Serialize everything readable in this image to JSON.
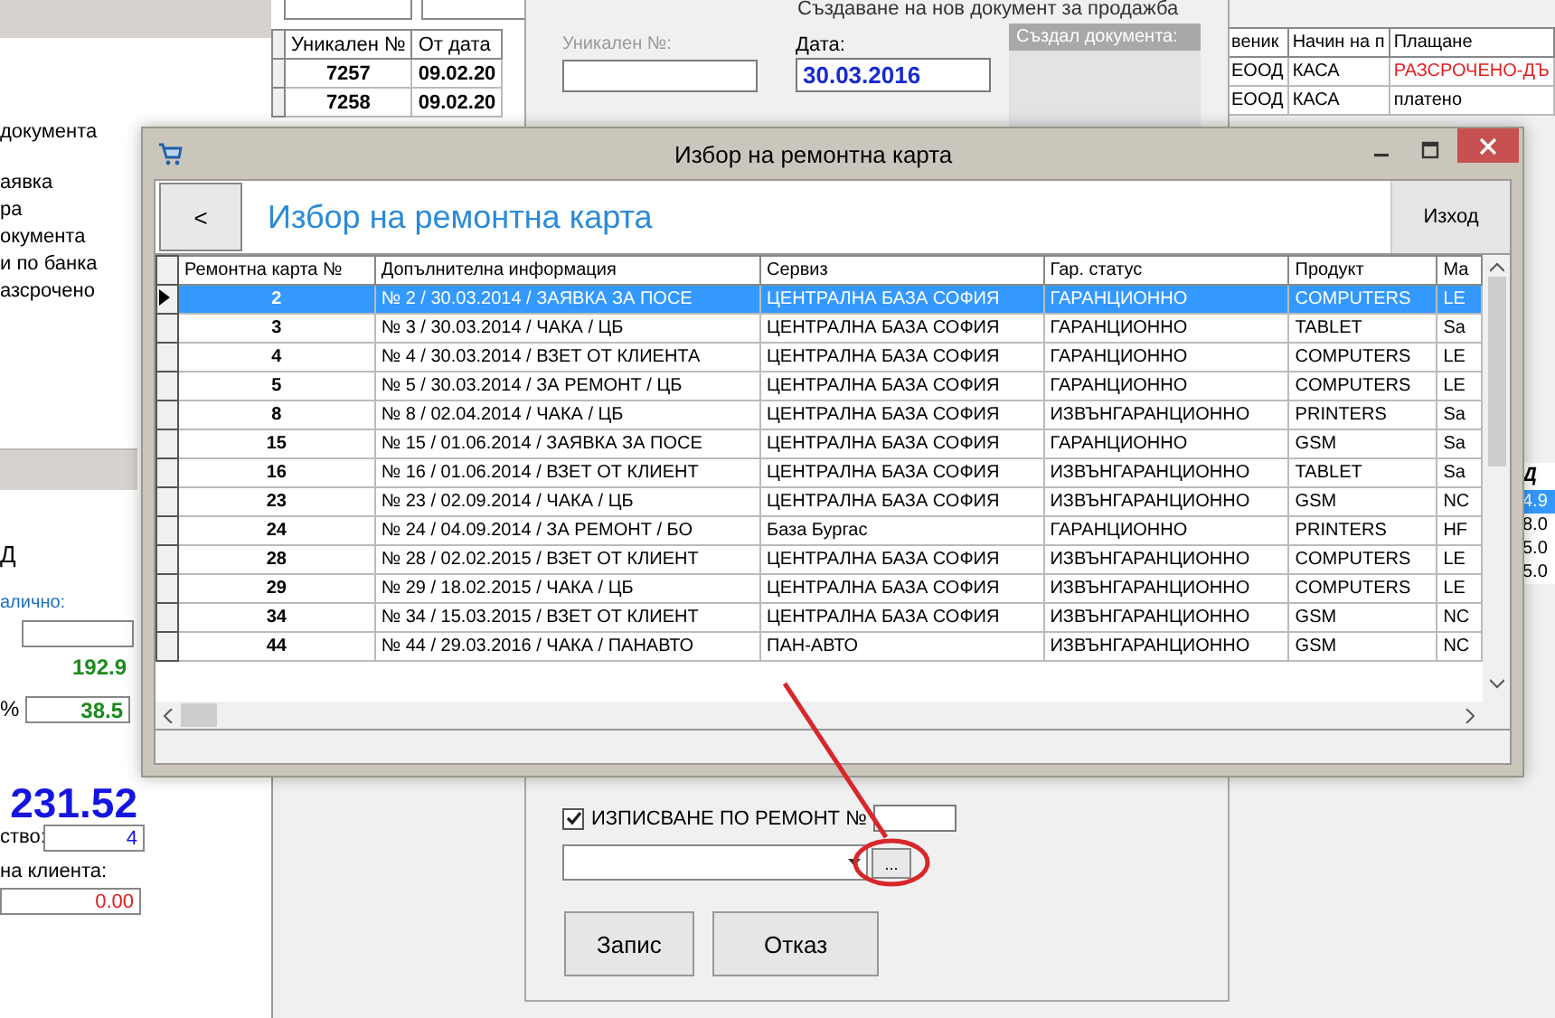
{
  "left_window": {
    "menu_items": [
      "документа",
      "аявка",
      "ра",
      "окумента",
      "и по банка",
      "азсрочено"
    ],
    "letter": "Д",
    "cash_label": "алично:",
    "amount": "192.9",
    "percent_label": "%",
    "percent": "38.5",
    "total": "231.52",
    "qty_label": "ство:",
    "qty": "4",
    "client_label": "на клиента:",
    "client_value": "0.00"
  },
  "back_table": {
    "columns": [
      "Уникален №",
      "От дата"
    ],
    "rows": [
      [
        "7257",
        "09.02.20"
      ],
      [
        "7258",
        "09.02.20"
      ]
    ]
  },
  "right_table": {
    "columns": [
      "веник",
      "Начин на п",
      "Плащане"
    ],
    "rows": [
      {
        "cells": [
          "ЕООД",
          "КАСА",
          "РАЗСРОЧЕНО-ДЪ"
        ],
        "overdue": true
      },
      {
        "cells": [
          "ЕООД",
          "КАСА",
          "платено"
        ],
        "overdue": false
      }
    ]
  },
  "right_column": {
    "header": "Д",
    "values": [
      {
        "text": "4.9",
        "selected": true
      },
      {
        "text": "8.0",
        "selected": false
      },
      {
        "text": "5.0",
        "selected": false
      },
      {
        "text": "5.0",
        "selected": false
      }
    ]
  },
  "sale_window": {
    "title": "Създаване на нов документ за продажба",
    "number_label": "Уникален №:",
    "date_label": "Дата:",
    "date_value": "30.03.2016",
    "creator_label": "Създал документа:",
    "repair": {
      "label": "ИЗПИСВАНЕ ПО РЕМОНТ №",
      "checked": true
    },
    "browse_button": "...",
    "save_button": "Запис",
    "cancel_button": "Отказ"
  },
  "dialog": {
    "title": "Избор на ремонтна карта",
    "back_button": "<",
    "heading": "Избор на ремонтна карта",
    "exit_button": "Изход",
    "columns": [
      "Ремонтна карта №",
      "Допълнителна информация",
      "Сервиз",
      "Гар. статус",
      "Продукт",
      "Ма"
    ],
    "rows": [
      {
        "cells": [
          "2",
          "№ 2 / 30.03.2014 / ЗАЯВКА ЗА ПОСЕ",
          "ЦЕНТРАЛНА БАЗА СОФИЯ",
          "ГАРАНЦИОННО",
          "COMPUTERS",
          "LE"
        ],
        "selected": true
      },
      {
        "cells": [
          "3",
          "№ 3 / 30.03.2014 / ЧАКА / ЦБ",
          "ЦЕНТРАЛНА БАЗА СОФИЯ",
          "ГАРАНЦИОННО",
          "TABLET",
          "Sa"
        ],
        "selected": false
      },
      {
        "cells": [
          "4",
          "№ 4 / 30.03.2014 / ВЗЕТ ОТ КЛИЕНТА",
          "ЦЕНТРАЛНА БАЗА СОФИЯ",
          "ГАРАНЦИОННО",
          "COMPUTERS",
          "LE"
        ],
        "selected": false
      },
      {
        "cells": [
          "5",
          "№ 5 / 30.03.2014 / ЗА РЕМОНТ / ЦБ",
          "ЦЕНТРАЛНА БАЗА СОФИЯ",
          "ГАРАНЦИОННО",
          "COMPUTERS",
          "LE"
        ],
        "selected": false
      },
      {
        "cells": [
          "8",
          "№ 8 / 02.04.2014 / ЧАКА / ЦБ",
          "ЦЕНТРАЛНА БАЗА СОФИЯ",
          "ИЗВЪНГАРАНЦИОННО",
          "PRINTERS",
          "Sa"
        ],
        "selected": false
      },
      {
        "cells": [
          "15",
          "№ 15 / 01.06.2014 / ЗАЯВКА ЗА ПОСЕ",
          "ЦЕНТРАЛНА БАЗА СОФИЯ",
          "ГАРАНЦИОННО",
          "GSM",
          "Sa"
        ],
        "selected": false
      },
      {
        "cells": [
          "16",
          "№ 16 / 01.06.2014 / ВЗЕТ ОТ КЛИЕНТ",
          "ЦЕНТРАЛНА БАЗА СОФИЯ",
          "ИЗВЪНГАРАНЦИОННО",
          "TABLET",
          "Sa"
        ],
        "selected": false
      },
      {
        "cells": [
          "23",
          "№ 23 / 02.09.2014 / ЧАКА / ЦБ",
          "ЦЕНТРАЛНА БАЗА СОФИЯ",
          "ИЗВЪНГАРАНЦИОННО",
          "GSM",
          "NC"
        ],
        "selected": false
      },
      {
        "cells": [
          "24",
          "№ 24 / 04.09.2014 / ЗА РЕМОНТ / БО",
          "База Бургас",
          "ГАРАНЦИОННО",
          "PRINTERS",
          "HF"
        ],
        "selected": false
      },
      {
        "cells": [
          "28",
          "№ 28 / 02.02.2015 / ВЗЕТ ОТ КЛИЕНТ",
          "ЦЕНТРАЛНА БАЗА СОФИЯ",
          "ИЗВЪНГАРАНЦИОННО",
          "COMPUTERS",
          "LE"
        ],
        "selected": false
      },
      {
        "cells": [
          "29",
          "№ 29 / 18.02.2015 / ЧАКА / ЦБ",
          "ЦЕНТРАЛНА БАЗА СОФИЯ",
          "ИЗВЪНГАРАНЦИОННО",
          "COMPUTERS",
          "LE"
        ],
        "selected": false
      },
      {
        "cells": [
          "34",
          "№ 34 / 15.03.2015 / ВЗЕТ ОТ КЛИЕНТ",
          "ЦЕНТРАЛНА БАЗА СОФИЯ",
          "ИЗВЪНГАРАНЦИОННО",
          "GSM",
          "NC"
        ],
        "selected": false
      },
      {
        "cells": [
          "44",
          "№ 44 / 29.03.2016 / ЧАКА / ПАНАВТО",
          "ПАН-АВТО",
          "ИЗВЪНГАРАНЦИОННО",
          "GSM",
          "NC"
        ],
        "selected": false
      }
    ]
  }
}
